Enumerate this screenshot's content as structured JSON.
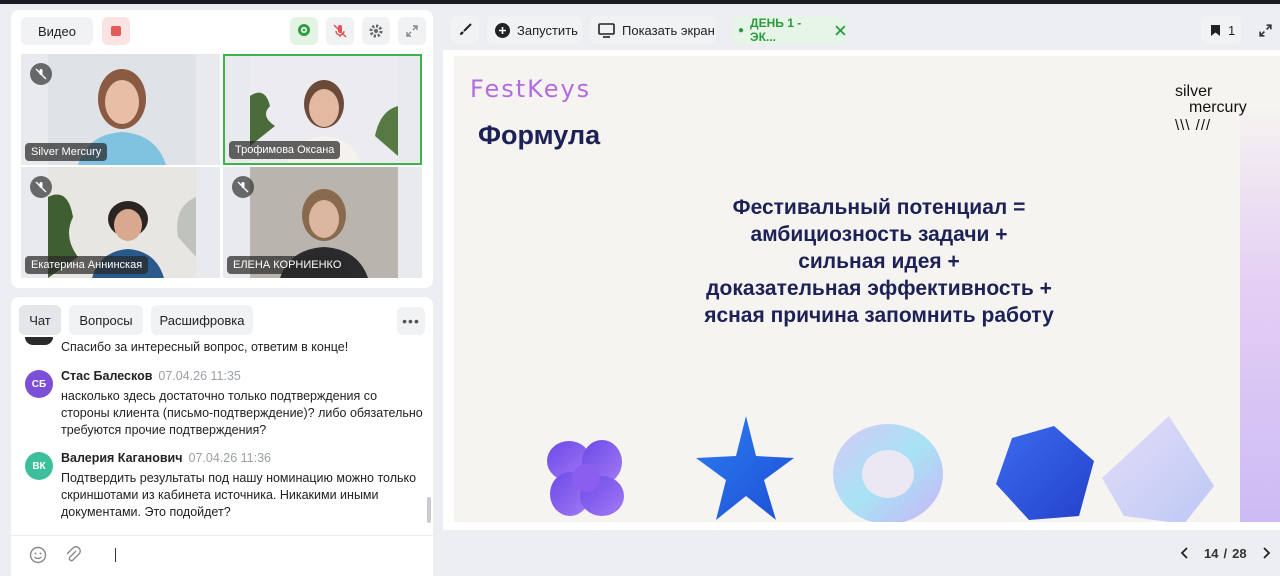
{
  "video_panel": {
    "video_button": "Видео",
    "participants": [
      {
        "name": "Silver Mercury"
      },
      {
        "name": "Трофимова Оксана"
      },
      {
        "name": "Екатерина Аннинская"
      },
      {
        "name": "ЕЛЕНА КОРНИЕНКО"
      }
    ]
  },
  "chat_panel": {
    "tabs": [
      "Чат",
      "Вопросы",
      "Расшифровка"
    ],
    "more_label": "•••",
    "messages": [
      {
        "text": "Спасибо за интересный вопрос, ответим в конце!"
      },
      {
        "initials": "СБ",
        "author": "Стас Балесков",
        "time": "07.04.26 11:35",
        "lines": [
          "насколько здесь достаточно только подтверждения со",
          "стороны клиента (письмо-подтверждение)? либо обязательно",
          "требуются прочие подтверждения?"
        ],
        "avatar_color": "#7b4fd6"
      },
      {
        "initials": "ВК",
        "author": "Валерия Каганович",
        "time": "07.04.26 11:36",
        "lines": [
          "Подтвердить результаты под нашу номинацию можно только",
          "скриншотами из кабинета источника. Никакими иными",
          "документами. Это подойдет?"
        ],
        "avatar_color": "#3cbf9a"
      }
    ]
  },
  "toolbar": {
    "launch_label": "Запустить",
    "share_screen_label": "Показать экран",
    "day_badge": "ДЕНЬ 1 - ЭК...",
    "bookmark_count": "1"
  },
  "slide": {
    "brand_left": "FestKeys",
    "brand_right": [
      "silver",
      "mercury",
      "\\\\\\ ///"
    ],
    "title": "Формула",
    "formula_lines": [
      "Фестивальный потенциал =",
      "амбициозность задачи +",
      "сильная идея +",
      "доказательная эффективность +",
      "ясная причина запомнить работу"
    ]
  },
  "pager": {
    "current": "14",
    "separator": "/",
    "total": "28"
  },
  "colors": {
    "accent_green": "#3bb54a",
    "slide_text": "#1c2156",
    "brand_purple": "#b46be0"
  }
}
